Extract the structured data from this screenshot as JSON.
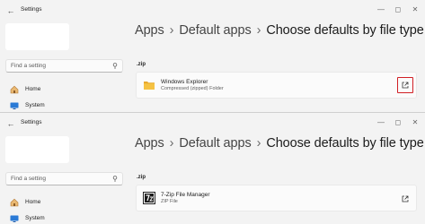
{
  "windows": [
    {
      "title": "Settings",
      "search_placeholder": "Find a setting",
      "nav": [
        {
          "label": "Home",
          "icon": "home-icon"
        },
        {
          "label": "System",
          "icon": "system-icon"
        }
      ],
      "breadcrumb": [
        "Apps",
        "Default apps",
        "Choose defaults by file type"
      ],
      "extension": ".zip",
      "app": {
        "name": "Windows Explorer",
        "description": "Compressed (zipped) Folder",
        "icon": "folder-icon"
      },
      "open_button_highlighted": true
    },
    {
      "title": "Settings",
      "search_placeholder": "Find a setting",
      "nav": [
        {
          "label": "Home",
          "icon": "home-icon"
        },
        {
          "label": "System",
          "icon": "system-icon"
        }
      ],
      "breadcrumb": [
        "Apps",
        "Default apps",
        "Choose defaults by file type"
      ],
      "extension": ".zip",
      "app": {
        "name": "7-Zip File Manager",
        "description": "ZIP File",
        "icon": "7zip-icon"
      },
      "open_button_highlighted": false
    }
  ],
  "colors": {
    "highlight": "#d11f25",
    "accent": "#0067c0",
    "folder": "#f5c242"
  }
}
